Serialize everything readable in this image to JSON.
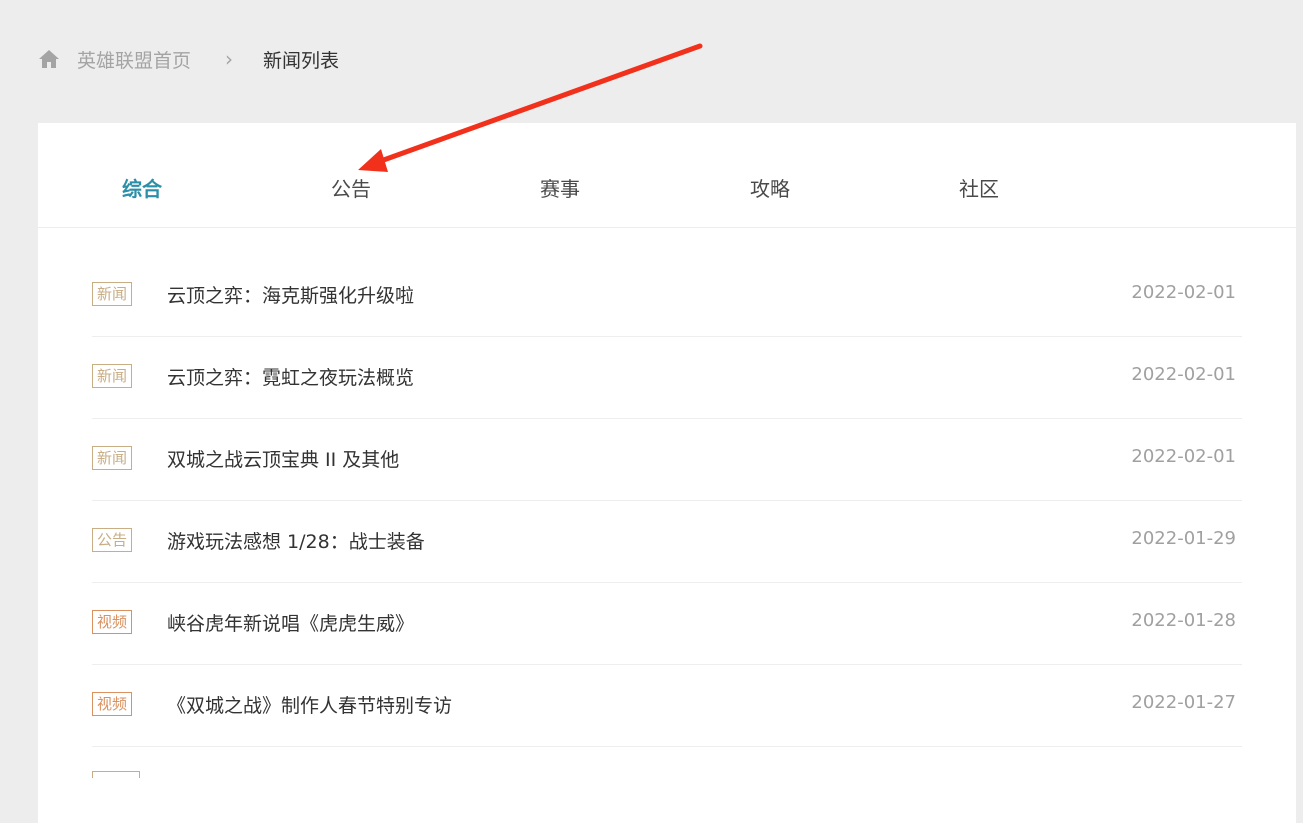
{
  "breadcrumb": {
    "home_icon": "home-icon",
    "home_label": "英雄联盟首页",
    "separator": "›",
    "current": "新闻列表"
  },
  "tabs": [
    {
      "label": "综合",
      "active": true
    },
    {
      "label": "公告",
      "active": false
    },
    {
      "label": "赛事",
      "active": false
    },
    {
      "label": "攻略",
      "active": false
    },
    {
      "label": "社区",
      "active": false
    }
  ],
  "news": [
    {
      "tag": "新闻",
      "title": "云顶之弈：海克斯强化升级啦",
      "date": "2022-02-01"
    },
    {
      "tag": "新闻",
      "title": "云顶之弈：霓虹之夜玩法概览",
      "date": "2022-02-01"
    },
    {
      "tag": "新闻",
      "title": "双城之战云顶宝典 II 及其他",
      "date": "2022-02-01"
    },
    {
      "tag": "公告",
      "title": "游戏玩法感想 1/28：战士装备",
      "date": "2022-01-29"
    },
    {
      "tag": "视频",
      "title": "峡谷虎年新说唱《虎虎生威》",
      "date": "2022-01-28"
    },
    {
      "tag": "视频",
      "title": "《双城之战》制作人春节特别专访",
      "date": "2022-01-27"
    }
  ],
  "colors": {
    "accent": "#2b8fa8",
    "tag_news": "#c8ad85",
    "tag_video": "#d9915f",
    "annotation_arrow": "#f2311c"
  }
}
